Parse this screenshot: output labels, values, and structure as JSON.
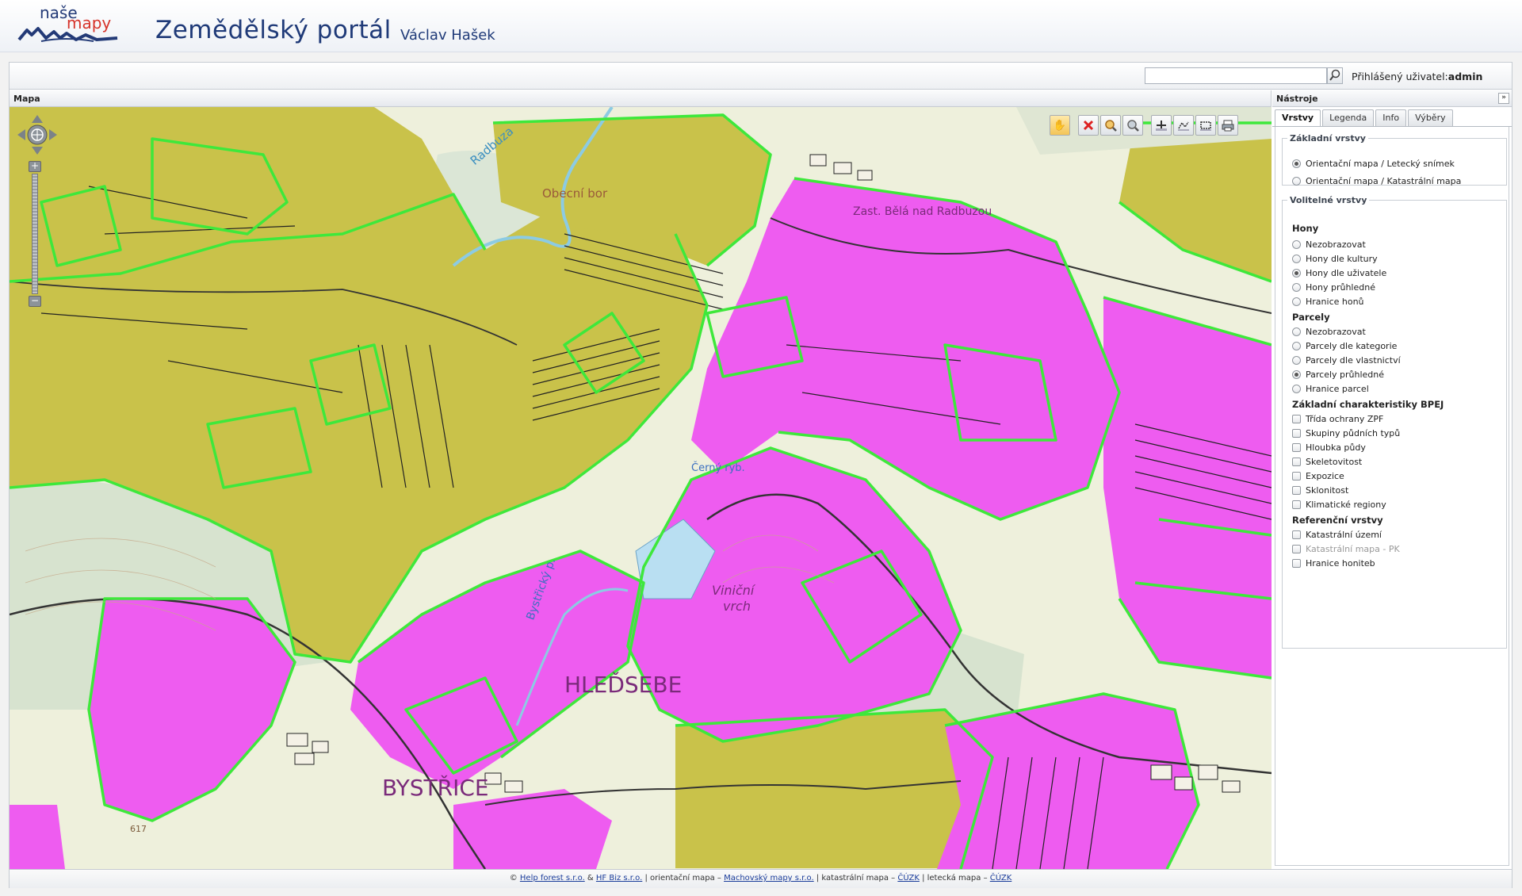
{
  "header": {
    "logo_top": "naše",
    "logo_bottom": "mapy",
    "title": "Zemědělský portál",
    "user": "Václav Hašek"
  },
  "topbar": {
    "search_value": "",
    "login_prefix": "Přihlášený uživatel:",
    "login_user": "admin"
  },
  "map": {
    "panel_title": "Mapa",
    "labels": {
      "river1": "Radbuza",
      "forest": "Obecní bor",
      "village1": "Zast. Bělá nad Radbuzou",
      "pond": "Černý ryb.",
      "hill1": "Viniční",
      "hill2": "vrch",
      "stream": "Bystřický p.",
      "town1": "HLEĎSEBE",
      "town2": "BYSTŘICE",
      "elev": "617"
    },
    "toolbar": [
      "pan-hand",
      "clear",
      "zoom-in-magnifier",
      "zoom-out-magnifier",
      "zoom-box",
      "measure-distance",
      "measure-area",
      "print"
    ]
  },
  "tools": {
    "panel_title": "Nástroje",
    "collapse": "»",
    "tabs": [
      "Vrstvy",
      "Legenda",
      "Info",
      "Výběry"
    ],
    "active_tab": "Vrstvy",
    "base_layers": {
      "legend": "Základní vrstvy",
      "items": [
        {
          "label": "Orientační mapa / Letecký snímek",
          "selected": true
        },
        {
          "label": "Orientační mapa / Katastrální mapa",
          "selected": false
        }
      ]
    },
    "optional_layers": {
      "legend": "Volitelné vrstvy",
      "hony_title": "Hony",
      "hony": [
        {
          "label": "Nezobrazovat",
          "selected": false
        },
        {
          "label": "Hony dle kultury",
          "selected": false
        },
        {
          "label": "Hony dle uživatele",
          "selected": true
        },
        {
          "label": "Hony průhledné",
          "selected": false
        },
        {
          "label": "Hranice honů",
          "selected": false
        }
      ],
      "parcely_title": "Parcely",
      "parcely": [
        {
          "label": "Nezobrazovat",
          "selected": false
        },
        {
          "label": "Parcely dle kategorie",
          "selected": false
        },
        {
          "label": "Parcely dle vlastnictví",
          "selected": false
        },
        {
          "label": "Parcely průhledné",
          "selected": true
        },
        {
          "label": "Hranice parcel",
          "selected": false
        }
      ],
      "bpej_title": "Základní charakteristiky BPEJ",
      "bpej": [
        {
          "label": "Třída ochrany ZPF",
          "checked": false
        },
        {
          "label": "Skupiny půdních typů",
          "checked": false
        },
        {
          "label": "Hloubka půdy",
          "checked": false
        },
        {
          "label": "Skeletovitost",
          "checked": false
        },
        {
          "label": "Expozice",
          "checked": false
        },
        {
          "label": "Sklonitost",
          "checked": false
        },
        {
          "label": "Klimatické regiony",
          "checked": false
        }
      ],
      "ref_title": "Referenční vrstvy",
      "ref": [
        {
          "label": "Katastrální území",
          "checked": false,
          "disabled": false
        },
        {
          "label": "Katastrální mapa - PK",
          "checked": false,
          "disabled": true
        },
        {
          "label": "Hranice honiteb",
          "checked": false,
          "disabled": false
        }
      ]
    }
  },
  "footer": {
    "copy": "©",
    "link1": "Help forest s.r.o.",
    "amp": " & ",
    "link2": "HF Biz s.r.o.",
    "t1": " | orientační mapa – ",
    "link3": "Machovský mapy s.r.o.",
    "t2": " | katastrální mapa – ",
    "link4": "ČÚZK",
    "t3": " | letecká mapa – ",
    "link5": "ČÚZK"
  },
  "colors": {
    "brand": "#1f3a78",
    "parcel_magenta": "#ee5cf0",
    "parcel_olive": "#c8c24a",
    "boundary_green": "#39e83a"
  }
}
